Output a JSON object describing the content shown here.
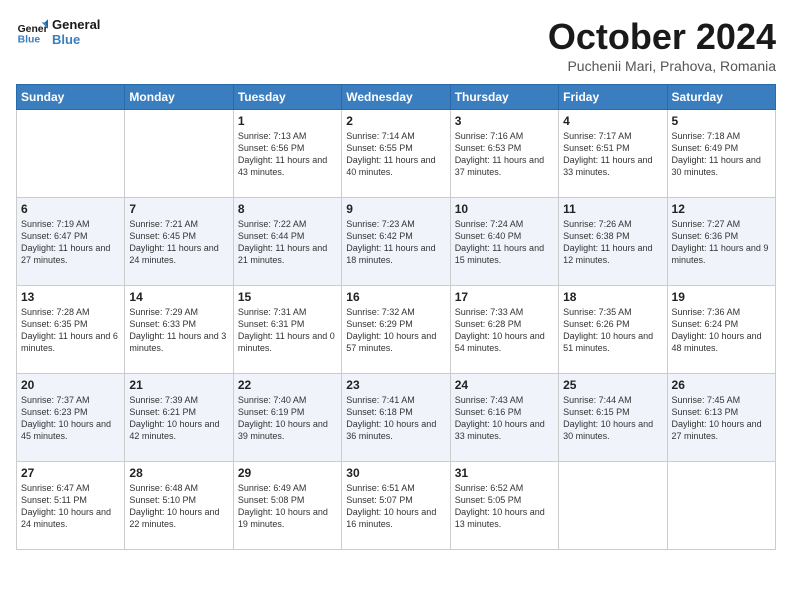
{
  "header": {
    "logo_general": "General",
    "logo_blue": "Blue",
    "month": "October 2024",
    "location": "Puchenii Mari, Prahova, Romania"
  },
  "days_of_week": [
    "Sunday",
    "Monday",
    "Tuesday",
    "Wednesday",
    "Thursday",
    "Friday",
    "Saturday"
  ],
  "weeks": [
    [
      {
        "day": "",
        "info": ""
      },
      {
        "day": "",
        "info": ""
      },
      {
        "day": "1",
        "info": "Sunrise: 7:13 AM\nSunset: 6:56 PM\nDaylight: 11 hours and 43 minutes."
      },
      {
        "day": "2",
        "info": "Sunrise: 7:14 AM\nSunset: 6:55 PM\nDaylight: 11 hours and 40 minutes."
      },
      {
        "day": "3",
        "info": "Sunrise: 7:16 AM\nSunset: 6:53 PM\nDaylight: 11 hours and 37 minutes."
      },
      {
        "day": "4",
        "info": "Sunrise: 7:17 AM\nSunset: 6:51 PM\nDaylight: 11 hours and 33 minutes."
      },
      {
        "day": "5",
        "info": "Sunrise: 7:18 AM\nSunset: 6:49 PM\nDaylight: 11 hours and 30 minutes."
      }
    ],
    [
      {
        "day": "6",
        "info": "Sunrise: 7:19 AM\nSunset: 6:47 PM\nDaylight: 11 hours and 27 minutes."
      },
      {
        "day": "7",
        "info": "Sunrise: 7:21 AM\nSunset: 6:45 PM\nDaylight: 11 hours and 24 minutes."
      },
      {
        "day": "8",
        "info": "Sunrise: 7:22 AM\nSunset: 6:44 PM\nDaylight: 11 hours and 21 minutes."
      },
      {
        "day": "9",
        "info": "Sunrise: 7:23 AM\nSunset: 6:42 PM\nDaylight: 11 hours and 18 minutes."
      },
      {
        "day": "10",
        "info": "Sunrise: 7:24 AM\nSunset: 6:40 PM\nDaylight: 11 hours and 15 minutes."
      },
      {
        "day": "11",
        "info": "Sunrise: 7:26 AM\nSunset: 6:38 PM\nDaylight: 11 hours and 12 minutes."
      },
      {
        "day": "12",
        "info": "Sunrise: 7:27 AM\nSunset: 6:36 PM\nDaylight: 11 hours and 9 minutes."
      }
    ],
    [
      {
        "day": "13",
        "info": "Sunrise: 7:28 AM\nSunset: 6:35 PM\nDaylight: 11 hours and 6 minutes."
      },
      {
        "day": "14",
        "info": "Sunrise: 7:29 AM\nSunset: 6:33 PM\nDaylight: 11 hours and 3 minutes."
      },
      {
        "day": "15",
        "info": "Sunrise: 7:31 AM\nSunset: 6:31 PM\nDaylight: 11 hours and 0 minutes."
      },
      {
        "day": "16",
        "info": "Sunrise: 7:32 AM\nSunset: 6:29 PM\nDaylight: 10 hours and 57 minutes."
      },
      {
        "day": "17",
        "info": "Sunrise: 7:33 AM\nSunset: 6:28 PM\nDaylight: 10 hours and 54 minutes."
      },
      {
        "day": "18",
        "info": "Sunrise: 7:35 AM\nSunset: 6:26 PM\nDaylight: 10 hours and 51 minutes."
      },
      {
        "day": "19",
        "info": "Sunrise: 7:36 AM\nSunset: 6:24 PM\nDaylight: 10 hours and 48 minutes."
      }
    ],
    [
      {
        "day": "20",
        "info": "Sunrise: 7:37 AM\nSunset: 6:23 PM\nDaylight: 10 hours and 45 minutes."
      },
      {
        "day": "21",
        "info": "Sunrise: 7:39 AM\nSunset: 6:21 PM\nDaylight: 10 hours and 42 minutes."
      },
      {
        "day": "22",
        "info": "Sunrise: 7:40 AM\nSunset: 6:19 PM\nDaylight: 10 hours and 39 minutes."
      },
      {
        "day": "23",
        "info": "Sunrise: 7:41 AM\nSunset: 6:18 PM\nDaylight: 10 hours and 36 minutes."
      },
      {
        "day": "24",
        "info": "Sunrise: 7:43 AM\nSunset: 6:16 PM\nDaylight: 10 hours and 33 minutes."
      },
      {
        "day": "25",
        "info": "Sunrise: 7:44 AM\nSunset: 6:15 PM\nDaylight: 10 hours and 30 minutes."
      },
      {
        "day": "26",
        "info": "Sunrise: 7:45 AM\nSunset: 6:13 PM\nDaylight: 10 hours and 27 minutes."
      }
    ],
    [
      {
        "day": "27",
        "info": "Sunrise: 6:47 AM\nSunset: 5:11 PM\nDaylight: 10 hours and 24 minutes."
      },
      {
        "day": "28",
        "info": "Sunrise: 6:48 AM\nSunset: 5:10 PM\nDaylight: 10 hours and 22 minutes."
      },
      {
        "day": "29",
        "info": "Sunrise: 6:49 AM\nSunset: 5:08 PM\nDaylight: 10 hours and 19 minutes."
      },
      {
        "day": "30",
        "info": "Sunrise: 6:51 AM\nSunset: 5:07 PM\nDaylight: 10 hours and 16 minutes."
      },
      {
        "day": "31",
        "info": "Sunrise: 6:52 AM\nSunset: 5:05 PM\nDaylight: 10 hours and 13 minutes."
      },
      {
        "day": "",
        "info": ""
      },
      {
        "day": "",
        "info": ""
      }
    ]
  ]
}
